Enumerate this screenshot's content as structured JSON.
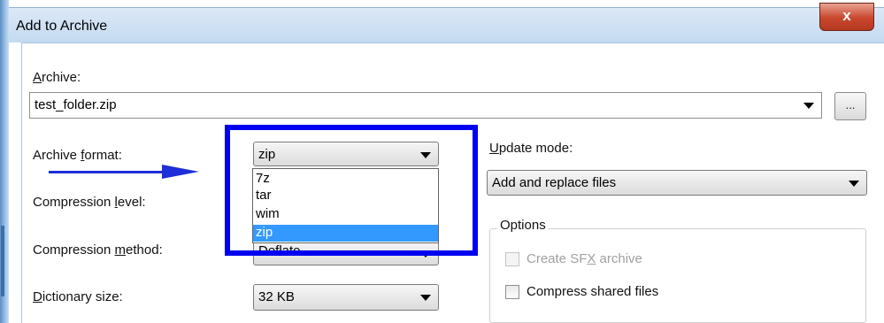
{
  "window": {
    "title": "Add to Archive",
    "close_glyph": "x"
  },
  "archive": {
    "label_accel": "A",
    "label_rest": "rchive:",
    "value": "test_folder.zip",
    "browse_label": "..."
  },
  "archive_format": {
    "label_pre": "Archive ",
    "label_accel": "f",
    "label_post": "ormat:",
    "value": "zip",
    "options": [
      "7z",
      "tar",
      "wim",
      "zip"
    ],
    "selected": "zip"
  },
  "compression_level": {
    "label_pre": "Compression ",
    "label_accel": "l",
    "label_post": "evel:"
  },
  "compression_method": {
    "label_pre": "Compression ",
    "label_accel": "m",
    "label_post": "ethod:",
    "value_partial": "Deflate"
  },
  "dictionary_size": {
    "label_accel": "D",
    "label_post": "ictionary size:",
    "value": "32 KB"
  },
  "update_mode": {
    "label_accel": "U",
    "label_post": "pdate mode:",
    "value": "Add and replace files"
  },
  "options": {
    "title": "Options",
    "sfx": {
      "label_pre": "Create SF",
      "label_accel": "X",
      "label_post": " archive",
      "checked": false,
      "disabled": true
    },
    "shared": {
      "label": "Compress shared files",
      "checked": false,
      "disabled": false
    }
  },
  "colors": {
    "highlight": "#0000f0",
    "arrow": "#1c2fd8",
    "selection": "#3399ff"
  }
}
